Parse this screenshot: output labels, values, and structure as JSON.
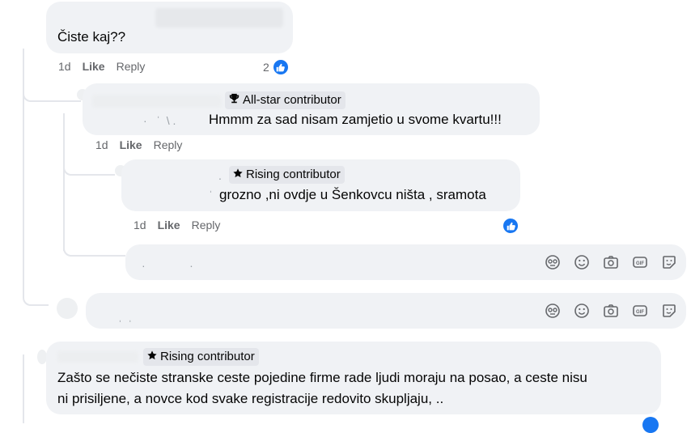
{
  "comments": [
    {
      "text": "Čiste kaj??",
      "time": "1d",
      "like_label": "Like",
      "reply_label": "Reply",
      "reaction_count": "2"
    },
    {
      "badge": "All-star contributor",
      "badge_icon": "trophy-icon",
      "text": "Hmmm za sad nisam zamjetio u svome kvartu!!!",
      "time": "1d",
      "like_label": "Like",
      "reply_label": "Reply"
    },
    {
      "badge": "Rising contributor",
      "badge_icon": "star-icon",
      "text": "grozno ,ni ovdje u Šenkovcu ništa , sramota",
      "time": "1d",
      "like_label": "Like",
      "reply_label": "Reply"
    },
    {
      "badge": "Rising contributor",
      "badge_icon": "star-icon",
      "text_line1": "Zašto se nečiste stranske ceste pojedine firme rade ljudi moraju na posao, a ceste nisu",
      "text_line2": "ni prisiljene, a novce kod svake registracije redovito skupljaju, .."
    }
  ],
  "composer_tools": [
    "avatar-sticker-icon",
    "emoji-icon",
    "camera-icon",
    "gif-icon",
    "sticker-icon"
  ],
  "colors": {
    "bubble": "#f0f2f5",
    "accent": "#1877f2",
    "meta_text": "#65676b",
    "badge_bg": "#e4e6eb"
  }
}
